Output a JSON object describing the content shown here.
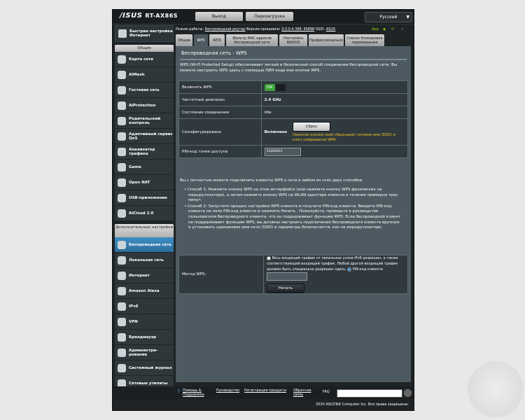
{
  "header": {
    "brand": "/ISUS",
    "model": "RT-AX86S",
    "logout": "Выход",
    "reboot": "Перезагрузка",
    "language": "Русский"
  },
  "status": {
    "mode_label": "Режим работы:",
    "mode_value": "Беспроводной роутер",
    "fw_label": "Версия прошивки:",
    "fw_value": "3.0.0.4.386_45898",
    "ssid_label": "SSID:",
    "ssid_value": "ASUS",
    "app": "App"
  },
  "sidebar": {
    "quick": "Быстрая настройка Интернет",
    "general": "Общие",
    "general_items": [
      "Карта сети",
      "AiMesh",
      "Гостевая сеть",
      "AiProtection",
      "Родительский контроль",
      "Адаптивный сервис QoS",
      "Анализатор трафика",
      "Game",
      "Open NAT",
      "USB-приложение",
      "AiCloud 2.0"
    ],
    "advanced": "Дополнительные настройки",
    "advanced_items": [
      "Беспроводная сеть",
      "Локальная сеть",
      "Интернет",
      "Amazon Alexa",
      "IPv6",
      "VPN",
      "Брандмауэр",
      "Администри-рование",
      "Системный журнал",
      "Сетевые утилиты"
    ]
  },
  "tabs": [
    "Общие",
    "WPS",
    "WDS",
    "Фильтр MAC адресов беспроводной сети",
    "Настройка RADIUS",
    "Профессионально",
    "Список блокировки перемещения"
  ],
  "page": {
    "title": "Беспроводная сеть - WPS",
    "desc": "WPS (Wi-Fi Protected Setup) обеспечивает легкий и безопасный способ соединения беспроводной сети. Вы можете настроить WPS здесь с помощью ПИН-кода или кнопки WPS.",
    "rows": {
      "enable_label": "Включить WPS",
      "enable_value": "ON",
      "band_label": "Частотный диапазон",
      "band_value": "2.4 GHz",
      "conn_label": "Состояние соединения",
      "conn_value": "Idle",
      "configured_label": "Сконфигурировано",
      "configured_value": "Включено",
      "reset_btn": "Сброс",
      "reset_note": "Нажатие кнопки reset сбрасывает сетевое имя (SSID) и ключ шифрования WPA.",
      "pin_label": "PIN-код точки доступа",
      "pin_value": "12400622"
    },
    "intro": "Вы с легкостью можете подключить клиенты WPS к сети в любом из этих двух способов:",
    "method1": "• Способ 1: Нажмите кнопку WPS на этом интерфейсе (или нажмите кнопку WPS физических на маршрутизаторе), а затем нажмите кнопку WPS на WLAN адаптере клиента в течение примерно трех минут.",
    "method2": "• Способ 2: Запустите процесс настройки WPS клиента и получите PIN-код клиента. Введите PIN-код клиента на поле PIN-код клиента и нажмите Начать . Пожалуйста, проверьте в руководстве пользователя беспроводного клиента, что он поддерживает функцию WPS. Если беспроводной клиент не поддерживает функцию WPS, вы должны настроить подключение беспроводного клиента вручную и установить одинаковое имя сети (SSID) и параметры безопасности, как на маршрутизаторе.",
    "method_label": "Метод WPS:",
    "method_radio1": "Весь входящий трафик от локальных узлов IPv6 разрешен, а также соответствующий входящий трафик. Любой другой входящий трафик должен быть специально разрешен здесь.",
    "method_radio2": "PIN-код клиента",
    "start_btn": "Начать"
  },
  "footer": {
    "help": "Помощь & Поддержка",
    "manual": "Руководство",
    "register": "Регистрация продукта",
    "feedback": "Обратная связь",
    "faq": "FAQ",
    "copyright": "2020 ASUSTeK Computer Inc. Все права защищены."
  }
}
